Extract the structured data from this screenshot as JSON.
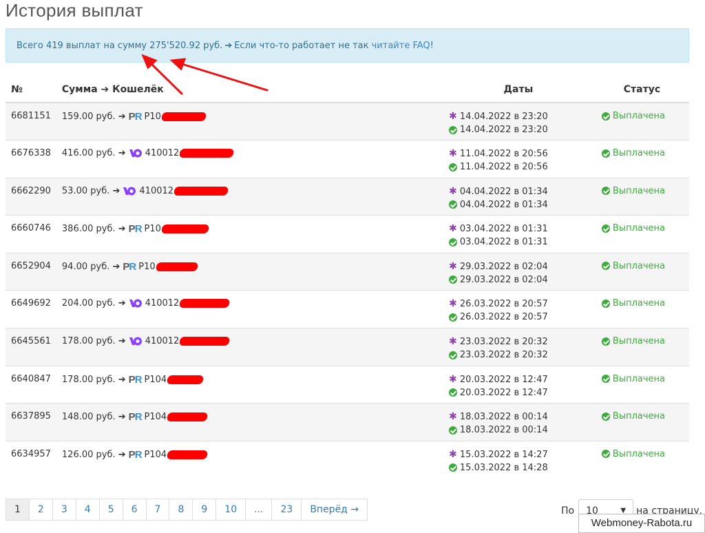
{
  "page": {
    "title": "История выплат"
  },
  "info": {
    "summary": "Всего 419 выплат на сумму 275'520.92 руб.",
    "separator": "➔",
    "hint": "Если что-то работает не так",
    "faq_link": "читайте FAQ",
    "suffix": "!"
  },
  "table": {
    "headers": {
      "id": "№",
      "sum": "Сумма",
      "wallet": "Кошелёк",
      "dates": "Даты",
      "status": "Статус"
    },
    "rows": [
      {
        "id": "6681151",
        "amount": "159.00 руб.",
        "wallet_type": "payeer",
        "wallet_prefix": "P10",
        "date_created": "14.04.2022 в 23:20",
        "date_paid": "14.04.2022 в 23:20",
        "status": "Выплачена"
      },
      {
        "id": "6676338",
        "amount": "416.00 руб.",
        "wallet_type": "yoomoney",
        "wallet_prefix": "410012",
        "date_created": "11.04.2022 в 20:56",
        "date_paid": "11.04.2022 в 20:56",
        "status": "Выплачена"
      },
      {
        "id": "6662290",
        "amount": "53.00 руб.",
        "wallet_type": "yoomoney",
        "wallet_prefix": "410012",
        "date_created": "04.04.2022 в 01:34",
        "date_paid": "04.04.2022 в 01:34",
        "status": "Выплачена"
      },
      {
        "id": "6660746",
        "amount": "386.00 руб.",
        "wallet_type": "payeer",
        "wallet_prefix": "P10",
        "date_created": "03.04.2022 в 01:31",
        "date_paid": "03.04.2022 в 01:31",
        "status": "Выплачена"
      },
      {
        "id": "6652904",
        "amount": "94.00 руб.",
        "wallet_type": "payeer",
        "wallet_prefix": "P10",
        "date_created": "29.03.2022 в 02:04",
        "date_paid": "29.03.2022 в 02:04",
        "status": "Выплачена"
      },
      {
        "id": "6649692",
        "amount": "204.00 руб.",
        "wallet_type": "yoomoney",
        "wallet_prefix": "410012",
        "date_created": "26.03.2022 в 20:57",
        "date_paid": "26.03.2022 в 20:57",
        "status": "Выплачена"
      },
      {
        "id": "6645561",
        "amount": "178.00 руб.",
        "wallet_type": "yoomoney",
        "wallet_prefix": "410012",
        "date_created": "23.03.2022 в 20:32",
        "date_paid": "23.03.2022 в 20:32",
        "status": "Выплачена"
      },
      {
        "id": "6640847",
        "amount": "178.00 руб.",
        "wallet_type": "payeer",
        "wallet_prefix": "P104",
        "date_created": "20.03.2022 в 12:47",
        "date_paid": "20.03.2022 в 12:47",
        "status": "Выплачена"
      },
      {
        "id": "6637895",
        "amount": "148.00 руб.",
        "wallet_type": "payeer",
        "wallet_prefix": "P104",
        "date_created": "18.03.2022 в 00:14",
        "date_paid": "18.03.2022 в 00:14",
        "status": "Выплачена"
      },
      {
        "id": "6634957",
        "amount": "126.00 руб.",
        "wallet_type": "payeer",
        "wallet_prefix": "P104",
        "date_created": "15.03.2022 в 14:27",
        "date_paid": "15.03.2022 в 14:28",
        "status": "Выплачена"
      }
    ]
  },
  "icons": {
    "wallet_payeer": "payeer-icon",
    "wallet_yoomoney": "yoomoney-icon",
    "date_created": "asterisk-icon",
    "date_paid": "check-circle-icon",
    "arrow": "arrow-right-icon"
  },
  "colors": {
    "accent_purple": "#8e44ad",
    "success": "#3cab3c",
    "info_bg": "#d9edf7",
    "link": "#3a87c8",
    "redaction": "#ff0000"
  },
  "pagination": {
    "pages": [
      "1",
      "2",
      "3",
      "4",
      "5",
      "6",
      "7",
      "8",
      "9",
      "10",
      "...",
      "23"
    ],
    "active": "1",
    "next": "Вперёд →"
  },
  "per_page": {
    "label_before": "По",
    "value": "10",
    "label_after": "на страницу."
  },
  "watermark": "Webmoney-Rabota.ru"
}
